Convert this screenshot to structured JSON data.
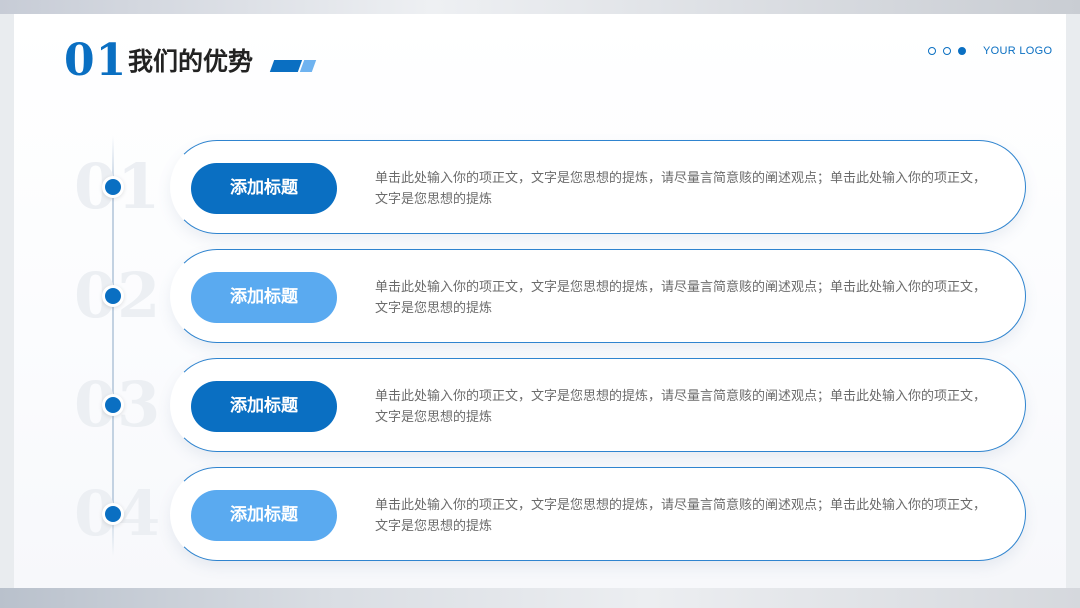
{
  "header": {
    "number": "01",
    "title": "我们的优势",
    "logo": "YOUR LOGO"
  },
  "colors": {
    "primary": "#0a6fc2",
    "light": "#5aaaf0"
  },
  "items": [
    {
      "index": "01",
      "title": "添加标题",
      "style": "dark",
      "text": "单击此处输入你的项正文，文字是您思想的提炼，请尽量言简意赅的阐述观点；单击此处输入你的项正文，文字是您思想的提炼"
    },
    {
      "index": "02",
      "title": "添加标题",
      "style": "light",
      "text": "单击此处输入你的项正文，文字是您思想的提炼，请尽量言简意赅的阐述观点；单击此处输入你的项正文，文字是您思想的提炼"
    },
    {
      "index": "03",
      "title": "添加标题",
      "style": "dark",
      "text": "单击此处输入你的项正文，文字是您思想的提炼，请尽量言简意赅的阐述观点；单击此处输入你的项正文，文字是您思想的提炼"
    },
    {
      "index": "04",
      "title": "添加标题",
      "style": "light",
      "text": "单击此处输入你的项正文，文字是您思想的提炼，请尽量言简意赅的阐述观点；单击此处输入你的项正文，文字是您思想的提炼"
    }
  ]
}
